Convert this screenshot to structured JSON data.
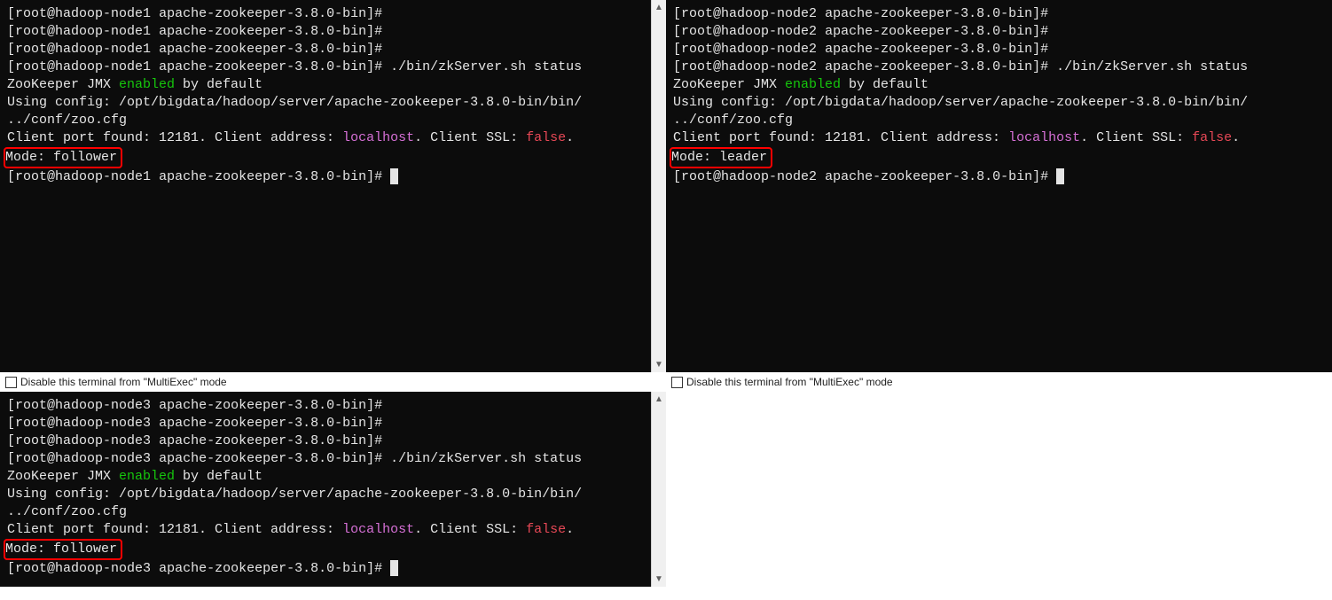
{
  "checkbox_label": "Disable this terminal from \"MultiExec\" mode",
  "terminals": [
    {
      "node": "hadoop-node1",
      "prompt_dir": "apache-zookeeper-3.8.0-bin",
      "cmd": "./bin/zkServer.sh status",
      "jmx_pre": "ZooKeeper JMX ",
      "jmx_enabled": "enabled",
      "jmx_post": " by default",
      "config_l1": "Using config: /opt/bigdata/hadoop/server/apache-zookeeper-3.8.0-bin/bin/",
      "config_l2": "../conf/zoo.cfg",
      "port_pre": "Client port found: 12181. Client address: ",
      "localhost": "localhost",
      "port_mid": ". Client SSL: ",
      "false": "false",
      "port_end": ".",
      "mode_text": "Mode: follower"
    },
    {
      "node": "hadoop-node2",
      "prompt_dir": "apache-zookeeper-3.8.0-bin",
      "cmd": "./bin/zkServer.sh status",
      "jmx_pre": "ZooKeeper JMX ",
      "jmx_enabled": "enabled",
      "jmx_post": " by default",
      "config_l1": "Using config: /opt/bigdata/hadoop/server/apache-zookeeper-3.8.0-bin/bin/",
      "config_l2": "../conf/zoo.cfg",
      "port_pre": "Client port found: 12181. Client address: ",
      "localhost": "localhost",
      "port_mid": ". Client SSL: ",
      "false": "false",
      "port_end": ".",
      "mode_text": "Mode: leader"
    },
    {
      "node": "hadoop-node3",
      "prompt_dir": "apache-zookeeper-3.8.0-bin",
      "cmd": "./bin/zkServer.sh status",
      "jmx_pre": "ZooKeeper JMX ",
      "jmx_enabled": "enabled",
      "jmx_post": " by default",
      "config_l1": "Using config: /opt/bigdata/hadoop/server/apache-zookeeper-3.8.0-bin/bin/",
      "config_l2": "../conf/zoo.cfg",
      "port_pre": "Client port found: 12181. Client address: ",
      "localhost": "localhost",
      "port_mid": ". Client SSL: ",
      "false": "false",
      "port_end": ".",
      "mode_text": "Mode: follower"
    }
  ],
  "prompt_open": "[root@",
  "prompt_close": "]# "
}
